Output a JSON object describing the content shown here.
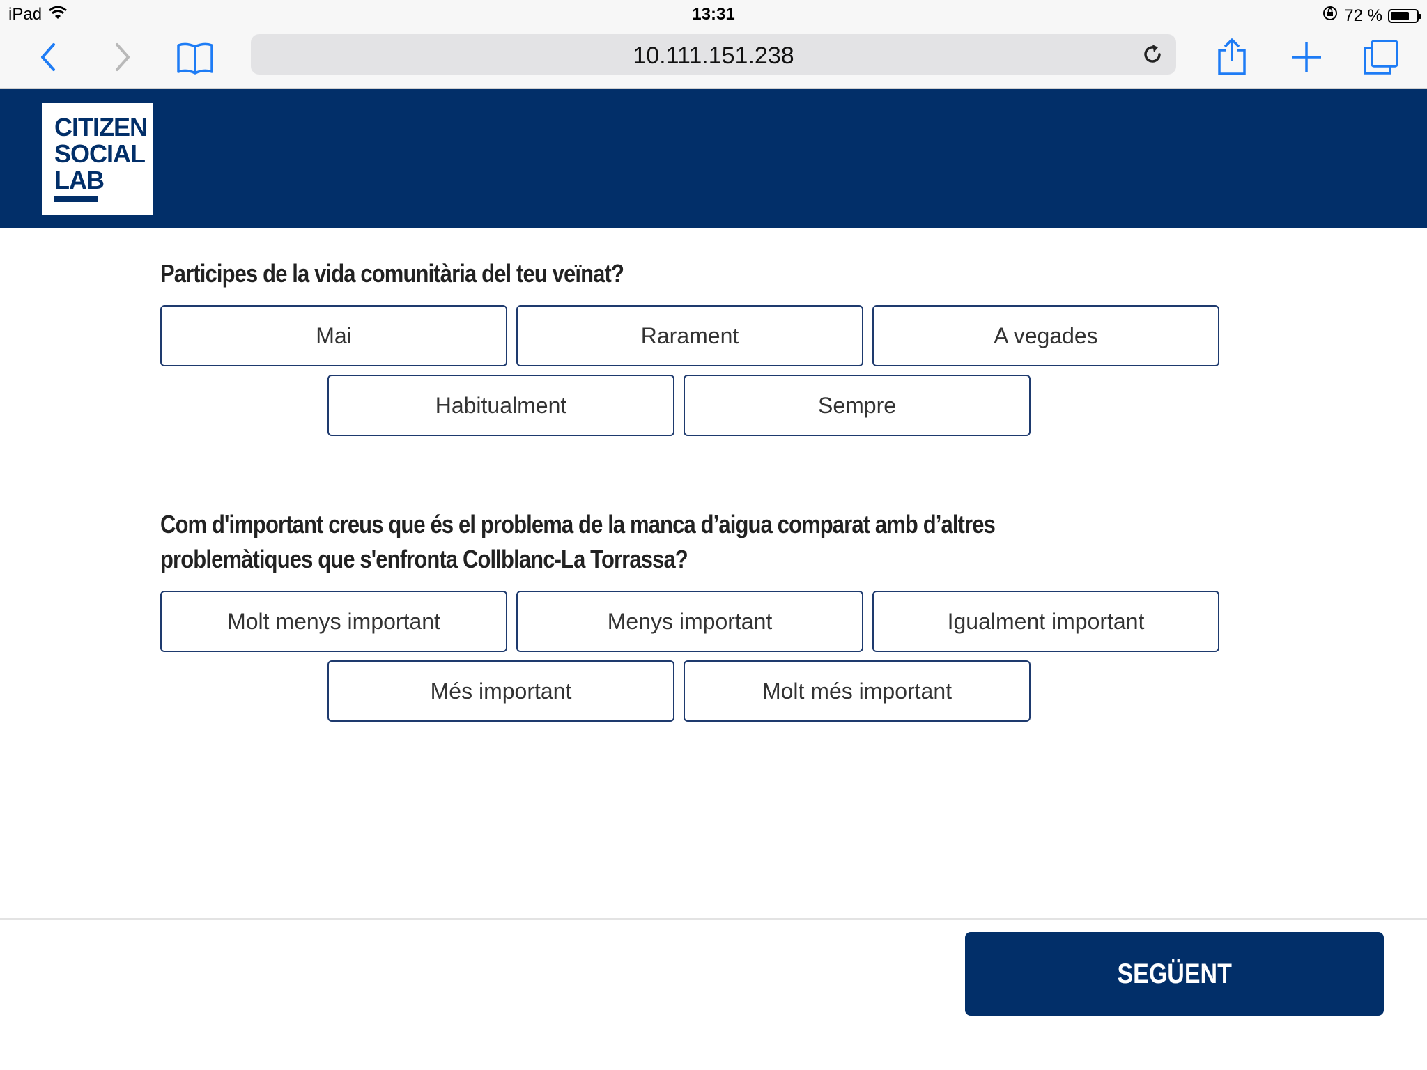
{
  "status_bar": {
    "device": "iPad",
    "time": "13:31",
    "battery_text": "72 %",
    "battery_level": 0.72,
    "icons": [
      "wifi-icon",
      "orientation-lock-icon",
      "battery-icon"
    ]
  },
  "toolbar": {
    "url": "10.111.151.238",
    "icons": [
      "back-icon",
      "forward-icon",
      "bookmarks-icon",
      "reload-icon",
      "share-icon",
      "new-tab-icon",
      "tabs-icon"
    ]
  },
  "header": {
    "logo_lines": [
      "CITIZEN",
      "SOCIAL",
      "LAB"
    ],
    "background_color": "#022f69"
  },
  "survey": {
    "questions": [
      {
        "text": "Participes de la vida comunitària del teu veïnat?",
        "options": [
          "Mai",
          "Rarament",
          "A vegades",
          "Habitualment",
          "Sempre"
        ]
      },
      {
        "text": "Com d'important creus que és el problema de la manca d’aigua comparat amb d’altres problemàtiques que s'enfronta Collblanc-La Torrassa?",
        "options": [
          "Molt menys important",
          "Menys important",
          "Igualment important",
          "Més important",
          "Molt més important"
        ]
      }
    ]
  },
  "footer": {
    "next_label": "SEGÜENT"
  }
}
